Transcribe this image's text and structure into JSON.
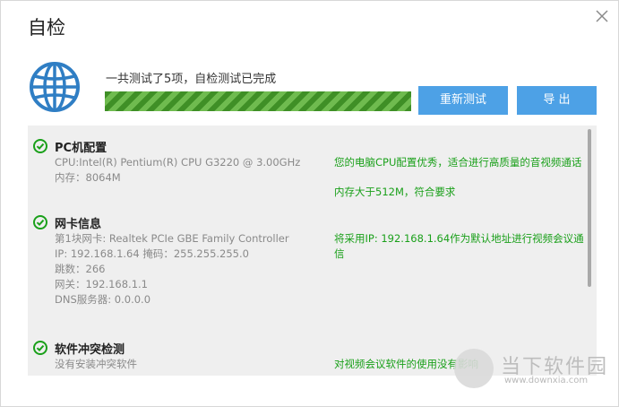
{
  "window": {
    "title": "自检"
  },
  "summary": {
    "text": "一共测试了5项，自检测试已完成",
    "progress_percent": 100
  },
  "buttons": {
    "retest_label": "重新测试",
    "export_label": "导 出"
  },
  "icons": {
    "close": "close-icon",
    "globe": "globe-icon",
    "check": "check-icon"
  },
  "colors": {
    "accent": "#4da1e6",
    "success": "#1aa01a",
    "progress": "#3f8f26"
  },
  "sections": [
    {
      "title": "PC机配置",
      "details": [
        "CPU:Intel(R) Pentium(R) CPU G3220 @ 3.00GHz",
        "内存：8064M"
      ],
      "results": [
        "您的电脑CPU配置优秀，适合进行高质量的音视频通话",
        "内存大于512M，符合要求"
      ]
    },
    {
      "title": "网卡信息",
      "details": [
        "第1块网卡: Realtek PCIe GBE Family Controller",
        "IP: 192.168.1.64  掩码：255.255.255.0",
        "跳数：266",
        "网关：192.168.1.1",
        "DNS服务器: 0.0.0.0"
      ],
      "results": [
        "将采用IP: 192.168.1.64作为默认地址进行视频会议通信"
      ]
    },
    {
      "title": "软件冲突检测",
      "details": [
        "没有安装冲突软件"
      ],
      "results": [
        "对视频会议软件的使用没有影响"
      ]
    }
  ],
  "watermark": {
    "text": "当下软件园",
    "url": "www.downxia.com"
  }
}
